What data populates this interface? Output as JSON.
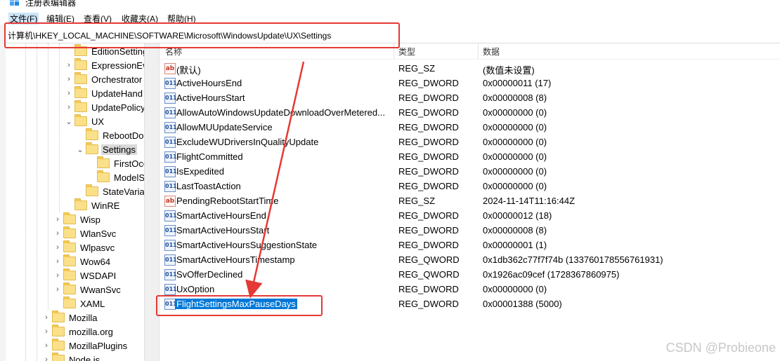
{
  "window": {
    "title": "注册表编辑器"
  },
  "menu": [
    "文件(F)",
    "编辑(E)",
    "查看(V)",
    "收藏夹(A)",
    "帮助(H)"
  ],
  "address": {
    "path": "计算机\\HKEY_LOCAL_MACHINE\\SOFTWARE\\Microsoft\\WindowsUpdate\\UX\\Settings"
  },
  "tree": [
    {
      "label": "EditionSetting",
      "chevron": ""
    },
    {
      "label": "ExpressionEv",
      "chevron": "›"
    },
    {
      "label": "Orchestrator",
      "chevron": "›"
    },
    {
      "label": "UpdateHand",
      "chevron": "›"
    },
    {
      "label": "UpdatePolicy",
      "chevron": "›"
    },
    {
      "label": "UX",
      "chevron": "⌄"
    },
    {
      "label": "RebootDo",
      "chevron": ""
    },
    {
      "label": "Settings",
      "chevron": "⌄"
    },
    {
      "label": "FirstOcc",
      "chevron": ""
    },
    {
      "label": "ModelS",
      "chevron": ""
    },
    {
      "label": "StateVaria",
      "chevron": ""
    },
    {
      "label": "WinRE",
      "chevron": ""
    },
    {
      "label": "Wisp",
      "chevron": "›"
    },
    {
      "label": "WlanSvc",
      "chevron": "›"
    },
    {
      "label": "Wlpasvc",
      "chevron": "›"
    },
    {
      "label": "Wow64",
      "chevron": "›"
    },
    {
      "label": "WSDAPI",
      "chevron": "›"
    },
    {
      "label": "WwanSvc",
      "chevron": "›"
    },
    {
      "label": "XAML",
      "chevron": ""
    },
    {
      "label": "Mozilla",
      "chevron": "›"
    },
    {
      "label": "mozilla.org",
      "chevron": "›"
    },
    {
      "label": "MozillaPlugins",
      "chevron": "›"
    },
    {
      "label": "Node.js",
      "chevron": "›"
    }
  ],
  "columns": {
    "name": "名称",
    "type": "类型",
    "data": "数据"
  },
  "values": [
    {
      "name": "(默认)",
      "type": "REG_SZ",
      "data": "(数值未设置)",
      "icon": "ab"
    },
    {
      "name": "ActiveHoursEnd",
      "type": "REG_DWORD",
      "data": "0x00000011 (17)",
      "icon": "dw"
    },
    {
      "name": "ActiveHoursStart",
      "type": "REG_DWORD",
      "data": "0x00000008 (8)",
      "icon": "dw"
    },
    {
      "name": "AllowAutoWindowsUpdateDownloadOverMetered...",
      "type": "REG_DWORD",
      "data": "0x00000000 (0)",
      "icon": "dw"
    },
    {
      "name": "AllowMUUpdateService",
      "type": "REG_DWORD",
      "data": "0x00000000 (0)",
      "icon": "dw"
    },
    {
      "name": "ExcludeWUDriversInQualityUpdate",
      "type": "REG_DWORD",
      "data": "0x00000000 (0)",
      "icon": "dw"
    },
    {
      "name": "FlightCommitted",
      "type": "REG_DWORD",
      "data": "0x00000000 (0)",
      "icon": "dw"
    },
    {
      "name": "IsExpedited",
      "type": "REG_DWORD",
      "data": "0x00000000 (0)",
      "icon": "dw"
    },
    {
      "name": "LastToastAction",
      "type": "REG_DWORD",
      "data": "0x00000000 (0)",
      "icon": "dw"
    },
    {
      "name": "PendingRebootStartTime",
      "type": "REG_SZ",
      "data": "2024-11-14T11:16:44Z",
      "icon": "ab"
    },
    {
      "name": "SmartActiveHoursEnd",
      "type": "REG_DWORD",
      "data": "0x00000012 (18)",
      "icon": "dw"
    },
    {
      "name": "SmartActiveHoursStart",
      "type": "REG_DWORD",
      "data": "0x00000008 (8)",
      "icon": "dw"
    },
    {
      "name": "SmartActiveHoursSuggestionState",
      "type": "REG_DWORD",
      "data": "0x00000001 (1)",
      "icon": "dw"
    },
    {
      "name": "SmartActiveHoursTimestamp",
      "type": "REG_QWORD",
      "data": "0x1db362c77f7f74b (133760178556761931)",
      "icon": "dw"
    },
    {
      "name": "SvOfferDeclined",
      "type": "REG_QWORD",
      "data": "0x1926ac09cef (1728367860975)",
      "icon": "dw"
    },
    {
      "name": "UxOption",
      "type": "REG_DWORD",
      "data": "0x00000000 (0)",
      "icon": "dw"
    },
    {
      "name": "FlightSettingsMaxPauseDays",
      "type": "REG_DWORD",
      "data": "0x00001388 (5000)",
      "icon": "dw",
      "selected": true
    }
  ],
  "icons": {
    "string": "ab",
    "binary": "011 110"
  },
  "colors": {
    "annotation": "#e53935",
    "selection": "#0078d7"
  },
  "watermark": "CSDN @Probieone"
}
